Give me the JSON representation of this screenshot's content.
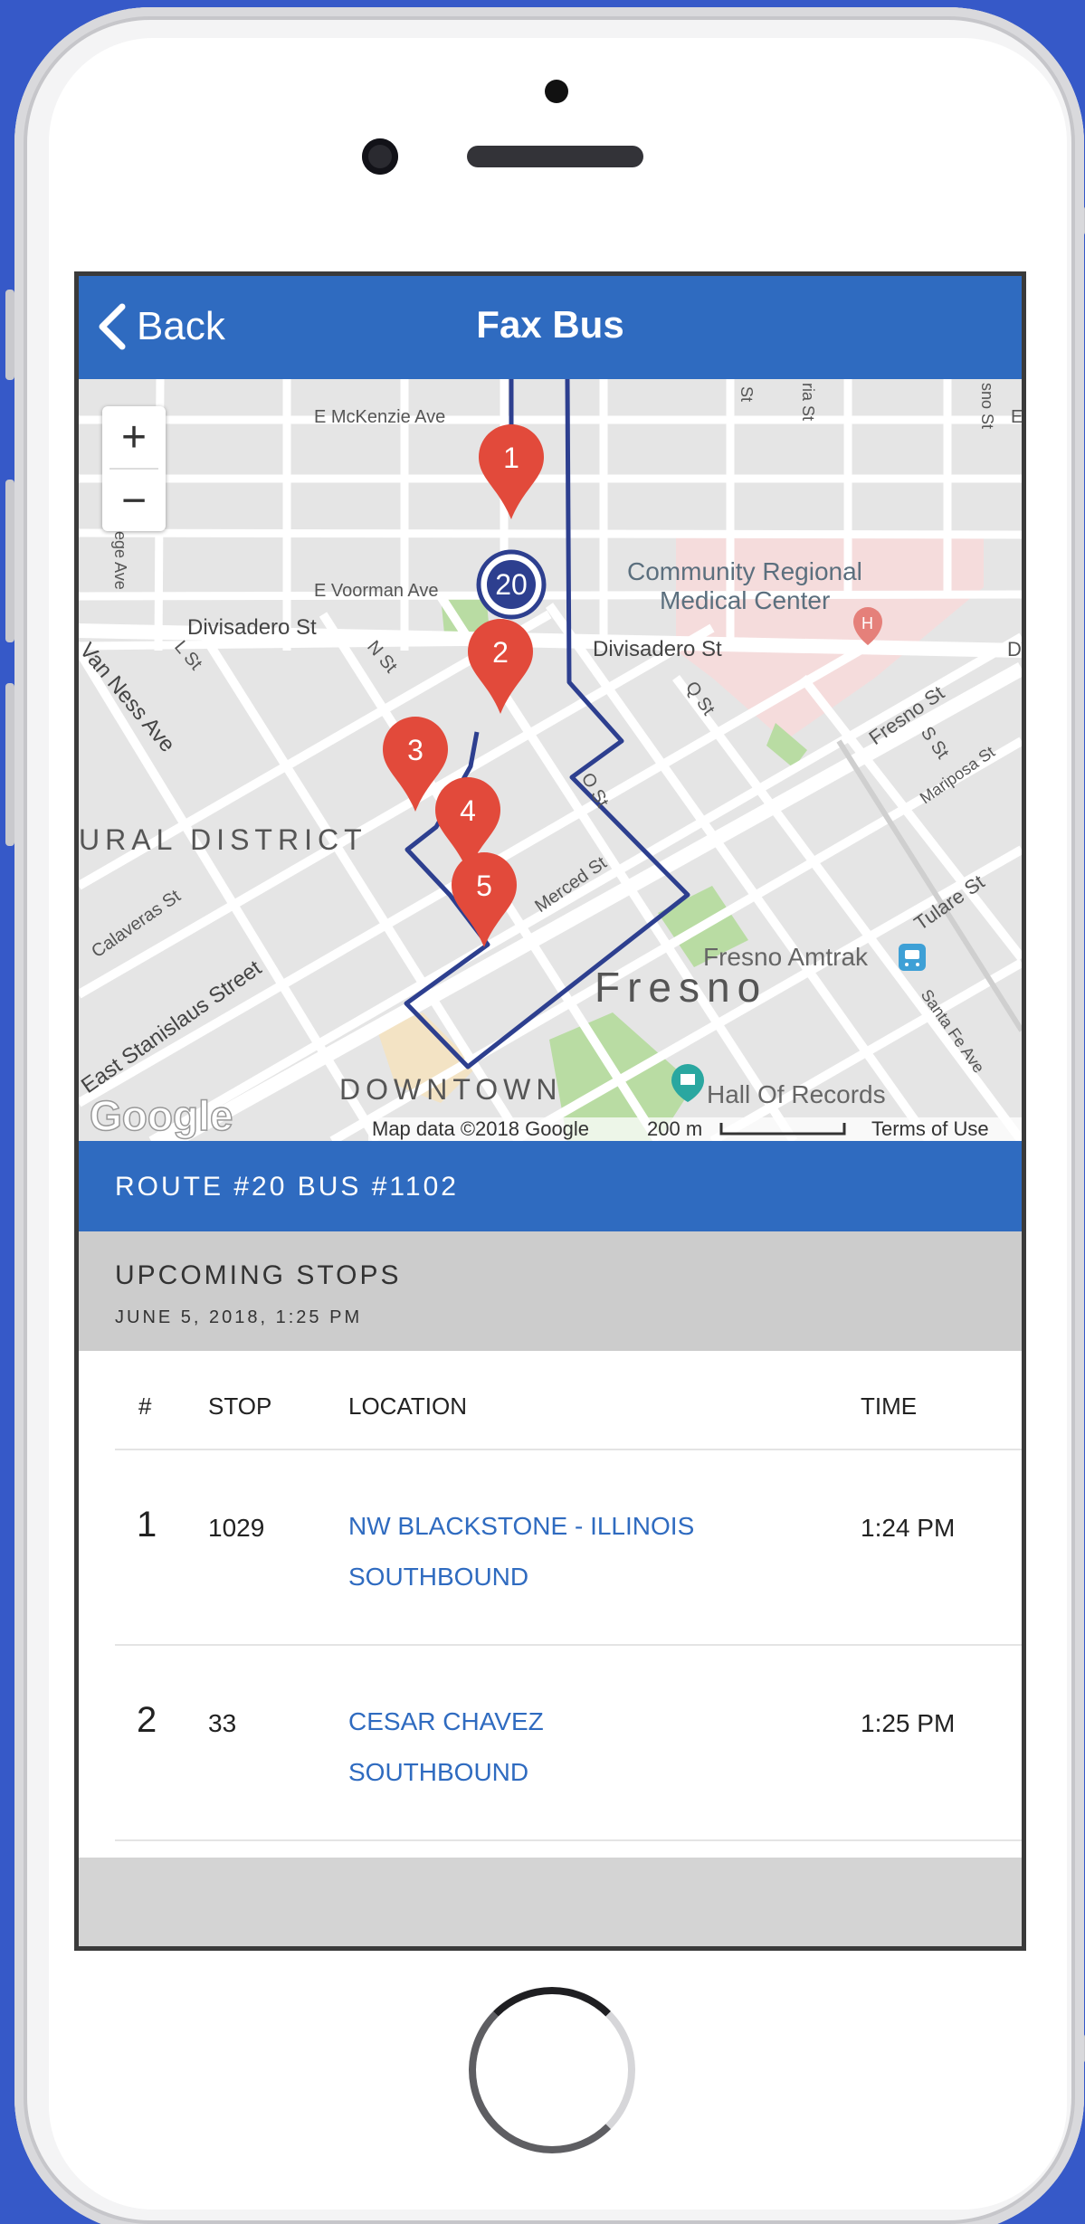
{
  "nav": {
    "back_label": "Back",
    "title": "Fax Bus"
  },
  "map": {
    "zoom_in": "+",
    "zoom_out": "−",
    "streets": {
      "mckenzie": "E McKenzie Ave",
      "voorman": "E Voorman Ave",
      "divisadero_left": "Divisadero St",
      "divisadero_right": "Divisadero St",
      "van_ness": "Van Ness Ave",
      "l_st": "L St",
      "n_st": "N St",
      "o_st": "O St",
      "q_st": "Q St",
      "s_st": "S St",
      "fresno_st": "Fresno St",
      "mariposa": "Mariposa St",
      "tulare": "Tulare St",
      "santa_fe": "Santa Fe Ave",
      "merced": "Merced St",
      "calaveras": "Calaveras St",
      "stanislaus": "East Stanislaus Street",
      "college": "llege Ave",
      "top_st1": "St",
      "top_st2": "ria St",
      "top_st3": "sno St",
      "edge_e": "E",
      "edge_d": "D"
    },
    "places": {
      "hospital_line1": "Community Regional",
      "hospital_line2": "Medical Center",
      "amtrak": "Fresno Amtrak",
      "hall": "Hall Of Records",
      "cultural": "URAL DISTRICT",
      "fresno": "Fresno",
      "downtown": "DOWNTOWN",
      "hospital_marker": "H"
    },
    "markers": [
      "1",
      "2",
      "3",
      "4",
      "5"
    ],
    "bus_number": "20",
    "footer": {
      "google": "Google",
      "map_data": "Map data ©2018 Google",
      "scale": "200 m",
      "terms": "Terms of Use"
    },
    "colors": {
      "route": "#2d3f8f",
      "marker": "#e24a3b",
      "park": "#b9dca3",
      "hospital_area": "#f5dcdc"
    }
  },
  "route_bar": "ROUTE #20 BUS #1102",
  "upcoming": {
    "title": "UPCOMING STOPS",
    "date": "JUNE 5, 2018, 1:25 PM"
  },
  "table": {
    "headers": {
      "num": "#",
      "stop": "STOP",
      "location": "LOCATION",
      "time": "TIME"
    },
    "rows": [
      {
        "num": "1",
        "stop": "1029",
        "loc1": "NW BLACKSTONE - ILLINOIS",
        "loc2": "SOUTHBOUND",
        "time": "1:24 PM"
      },
      {
        "num": "2",
        "stop": "33",
        "loc1": "CESAR CHAVEZ",
        "loc2": "SOUTHBOUND",
        "time": "1:25 PM"
      }
    ]
  }
}
